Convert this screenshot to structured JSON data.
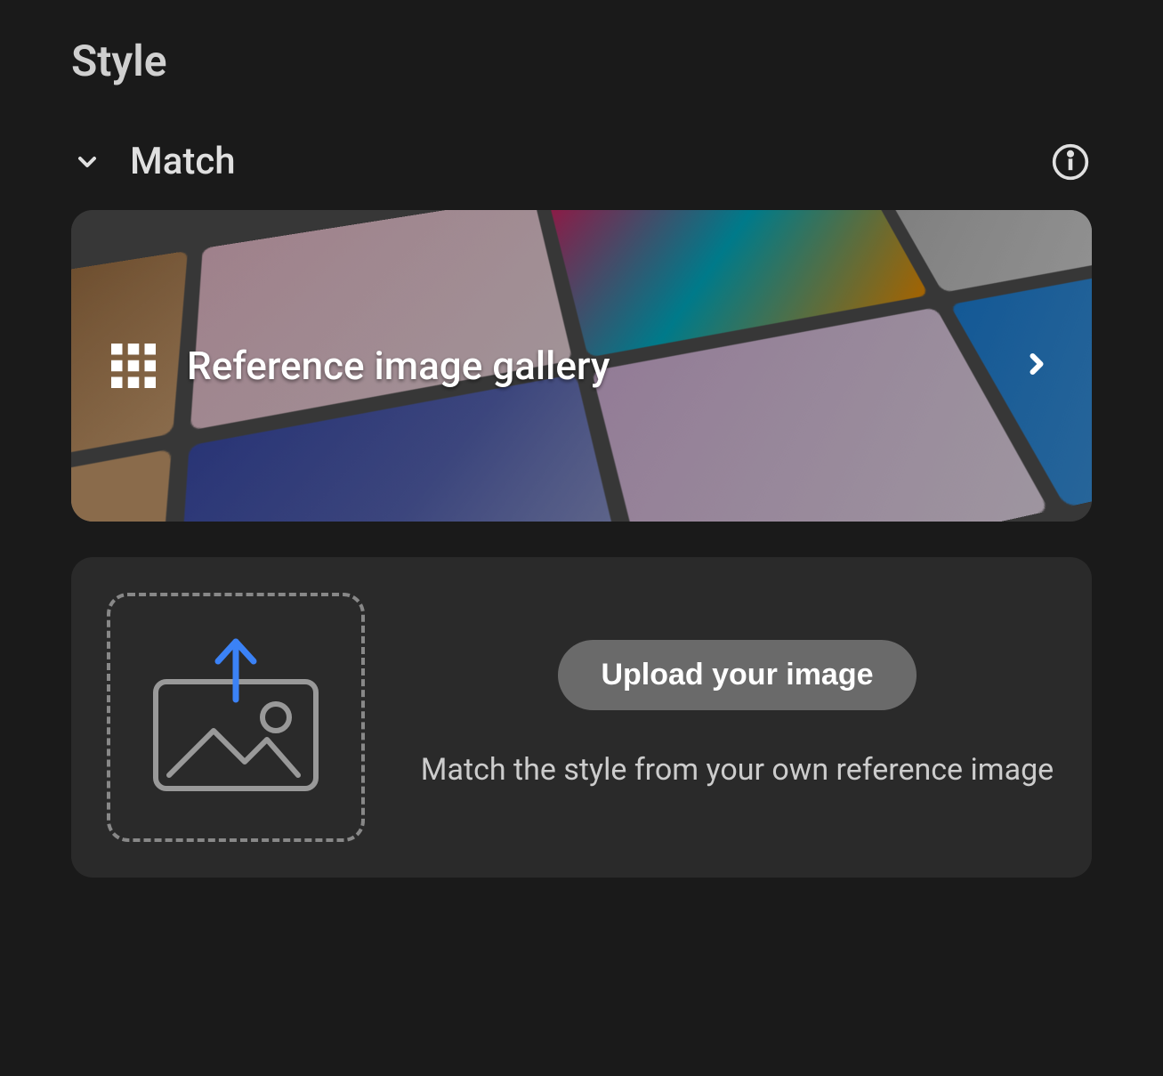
{
  "section": {
    "title": "Style"
  },
  "match": {
    "label": "Match"
  },
  "gallery": {
    "title": "Reference image gallery"
  },
  "upload": {
    "button_label": "Upload your image",
    "description": "Match the style from your own reference image"
  }
}
